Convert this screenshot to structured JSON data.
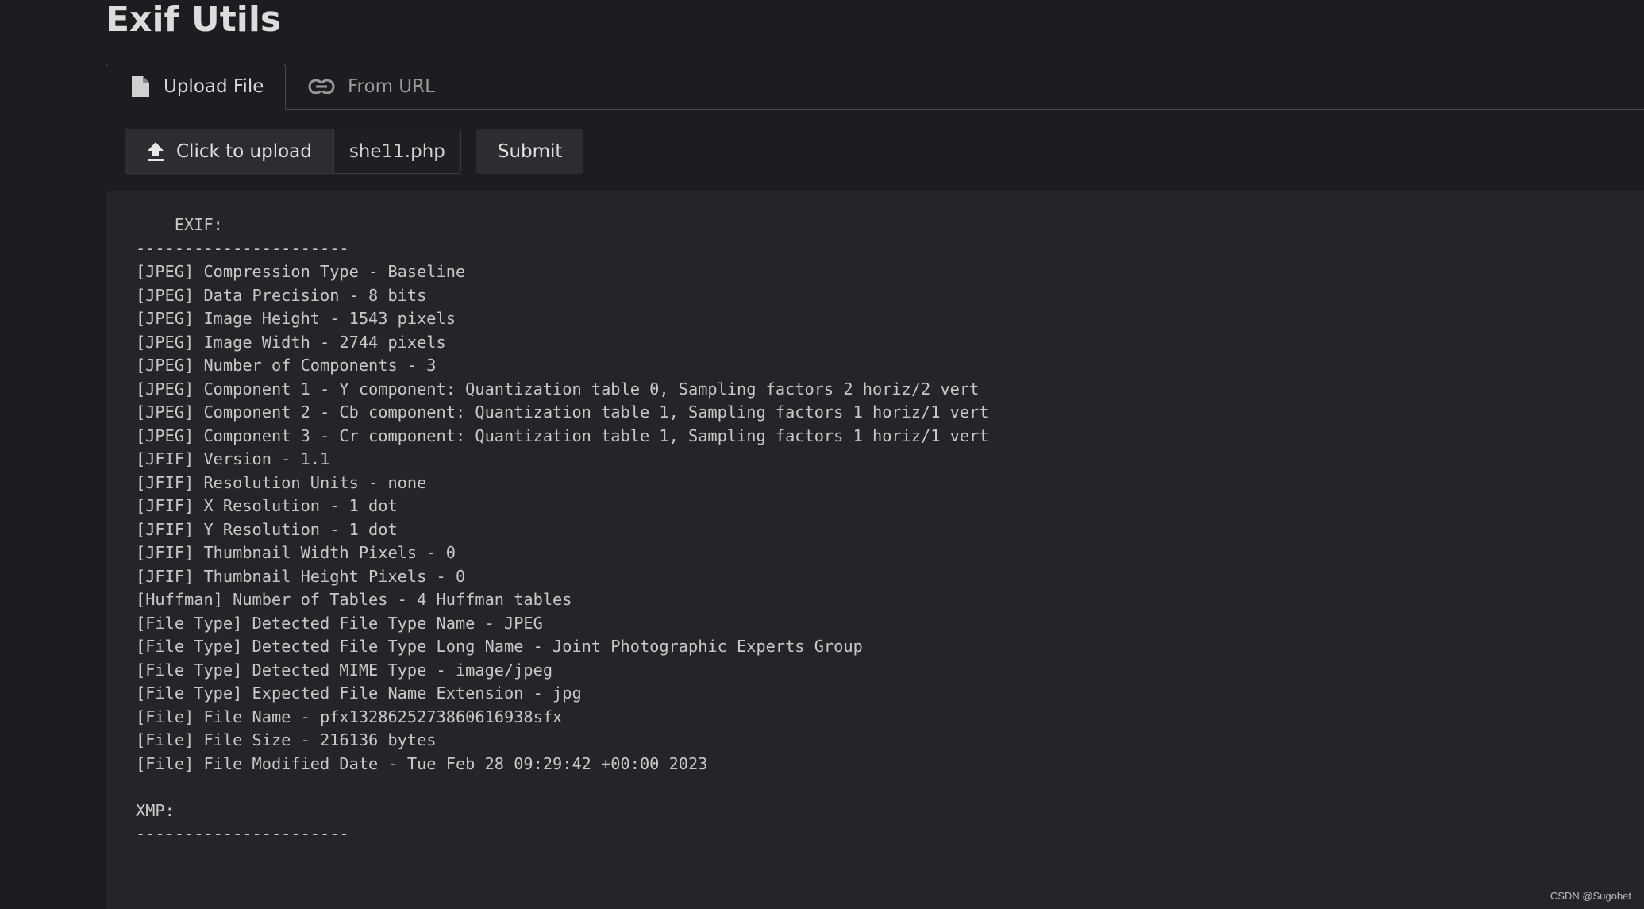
{
  "app": {
    "title": "Exif Utils"
  },
  "tabs": [
    {
      "label": "Upload File",
      "icon": "file-icon",
      "active": true
    },
    {
      "label": "From URL",
      "icon": "link-icon",
      "active": false
    }
  ],
  "upload": {
    "button_label": "Click to upload",
    "button_icon": "upload-icon",
    "selected_file": "she11.php",
    "submit_label": "Submit"
  },
  "output": {
    "exif_header": "    EXIF:",
    "separator": "----------------------",
    "exif_lines": [
      "[JPEG] Compression Type - Baseline",
      "[JPEG] Data Precision - 8 bits",
      "[JPEG] Image Height - 1543 pixels",
      "[JPEG] Image Width - 2744 pixels",
      "[JPEG] Number of Components - 3",
      "[JPEG] Component 1 - Y component: Quantization table 0, Sampling factors 2 horiz/2 vert",
      "[JPEG] Component 2 - Cb component: Quantization table 1, Sampling factors 1 horiz/1 vert",
      "[JPEG] Component 3 - Cr component: Quantization table 1, Sampling factors 1 horiz/1 vert",
      "[JFIF] Version - 1.1",
      "[JFIF] Resolution Units - none",
      "[JFIF] X Resolution - 1 dot",
      "[JFIF] Y Resolution - 1 dot",
      "[JFIF] Thumbnail Width Pixels - 0",
      "[JFIF] Thumbnail Height Pixels - 0",
      "[Huffman] Number of Tables - 4 Huffman tables",
      "[File Type] Detected File Type Name - JPEG",
      "[File Type] Detected File Type Long Name - Joint Photographic Experts Group",
      "[File Type] Detected MIME Type - image/jpeg",
      "[File Type] Expected File Name Extension - jpg",
      "[File] File Name - pfx1328625273860616938sfx",
      "[File] File Size - 216136 bytes",
      "[File] File Modified Date - Tue Feb 28 09:29:42 +00:00 2023"
    ],
    "xmp_header": "XMP:"
  },
  "watermark": "CSDN @Sugobet",
  "colors": {
    "background": "#1c1d20",
    "output_background": "#242528",
    "button_background": "#2c2d31",
    "text": "#c8c8c8"
  }
}
